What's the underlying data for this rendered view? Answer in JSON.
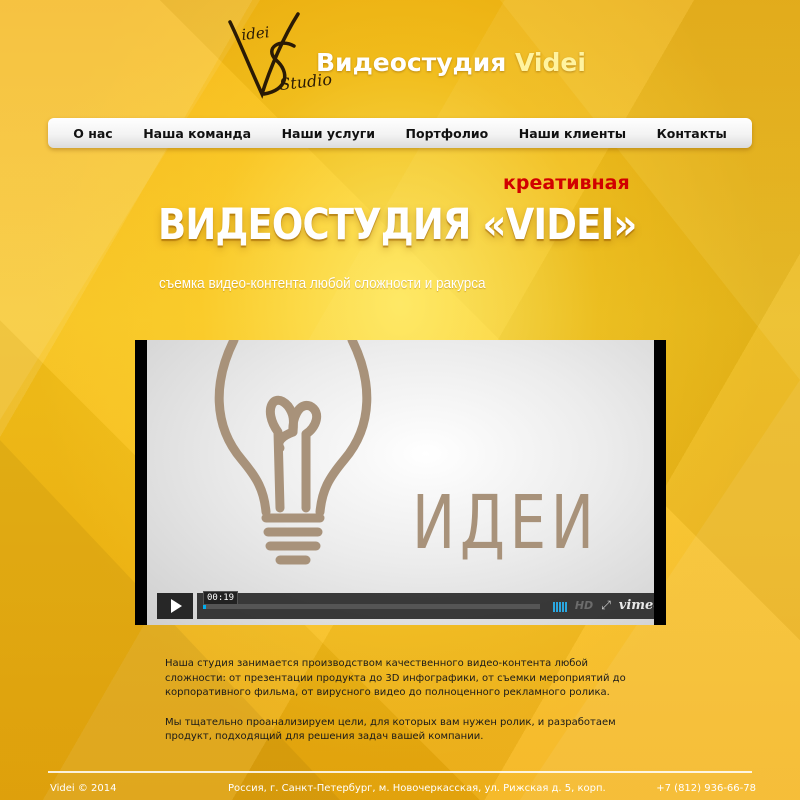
{
  "logo": {
    "mark_text_top": "idei",
    "mark_text_bottom": "Studio",
    "title": "Видеостудия",
    "title_accent": "Videi"
  },
  "nav": {
    "items": [
      {
        "label": "О нас"
      },
      {
        "label": "Наша команда"
      },
      {
        "label": "Наши услуги"
      },
      {
        "label": "Портфолио"
      },
      {
        "label": "Наши клиенты"
      },
      {
        "label": "Контакты"
      }
    ]
  },
  "hero": {
    "tag": "креативная",
    "title": "ВИДЕОСТУДИЯ «VIDEI»",
    "subtitle": "съемка видео-контента любой сложности и ракурса"
  },
  "video": {
    "word": "ИДЕИ",
    "timecode": "00:19",
    "progress": 0.01,
    "hd_label": "HD",
    "brand": "vimeo",
    "icons": [
      "lightbulb-icon",
      "play-icon",
      "volume-icon",
      "fullscreen-icon"
    ]
  },
  "description": {
    "paragraph1": "Наша студия занимается производством качественного видео-контента любой сложности: от презентации продукта до 3D инфографики, от съемки мероприятий до корпоративного фильма, от вирусного видео до полноценного рекламного ролика.",
    "paragraph2": "Мы тщательно проанализируем цели, для которых вам нужен ролик, и разработаем продукт, подходящий для решения задач вашей компании."
  },
  "footer": {
    "copyright": "Videi © 2014",
    "address": "Россия, г. Санкт-Петербург, м. Новочеркасская, ул. Рижская д. 5, корп.",
    "phone": "+7 (812) 936-66-78"
  },
  "colors": {
    "background": "#f5b40c",
    "accent_red": "#d10000",
    "drawing": "#a8927a",
    "progress": "#00adef"
  }
}
